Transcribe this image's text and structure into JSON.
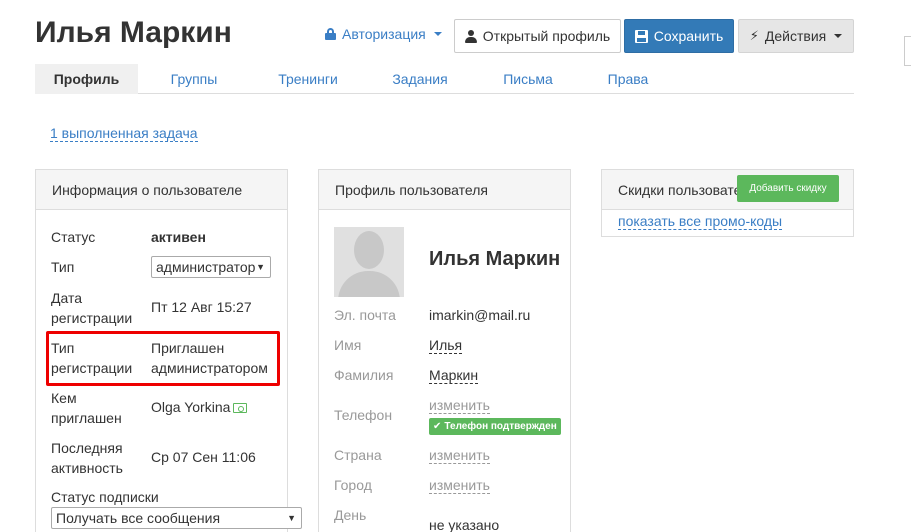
{
  "header": {
    "title": "Илья Маркин",
    "auth_label": "Авторизация",
    "open_profile_label": "Открытый профиль",
    "save_label": "Сохранить",
    "actions_label": "Действия"
  },
  "tabs": [
    {
      "label": "Профиль",
      "active": true
    },
    {
      "label": "Группы"
    },
    {
      "label": "Тренинги"
    },
    {
      "label": "Задания"
    },
    {
      "label": "Письма"
    },
    {
      "label": "Права"
    }
  ],
  "task_link": "1 выполненная задача",
  "user_info": {
    "title": "Информация о пользователе",
    "status_label": "Статус",
    "status_value": "активен",
    "type_label": "Тип",
    "type_value": "администратор",
    "reg_date_label_1": "Дата",
    "reg_date_label_2": "регистрации",
    "reg_date_value": "Пт 12 Авг 15:27",
    "reg_type_label_1": "Тип",
    "reg_type_label_2": "регистрации",
    "reg_type_value_1": "Приглашен",
    "reg_type_value_2": "администратором",
    "invited_label_1": "Кем",
    "invited_label_2": "приглашен",
    "invited_value": "Olga Yorkina",
    "last_active_label_1": "Последняя",
    "last_active_label_2": "активность",
    "last_active_value": "Ср 07 Сен 11:06",
    "sub_status_label": "Статус подписки",
    "sub_status_value": "Получать все сообщения"
  },
  "profile": {
    "title": "Профиль пользователя",
    "name": "Илья Маркин",
    "email_label": "Эл. почта",
    "email_value": "imarkin@mail.ru",
    "first_name_label": "Имя",
    "first_name_value": "Илья",
    "last_name_label": "Фамилия",
    "last_name_value": "Маркин",
    "phone_label": "Телефон",
    "phone_value": "изменить",
    "phone_badge": "Телефон подтвержден",
    "country_label": "Страна",
    "country_value": "изменить",
    "city_label": "Город",
    "city_value": "изменить",
    "birthday_label": "День",
    "birthday_value": "не указано"
  },
  "discounts": {
    "title": "Скидки пользовате",
    "add_button": "Добавить скидку",
    "promo_link": "показать все промо-коды"
  },
  "colors": {
    "link": "#3a7ec5",
    "primary": "#337ab7",
    "success": "#5cb85c",
    "highlight": "#ee0000"
  }
}
